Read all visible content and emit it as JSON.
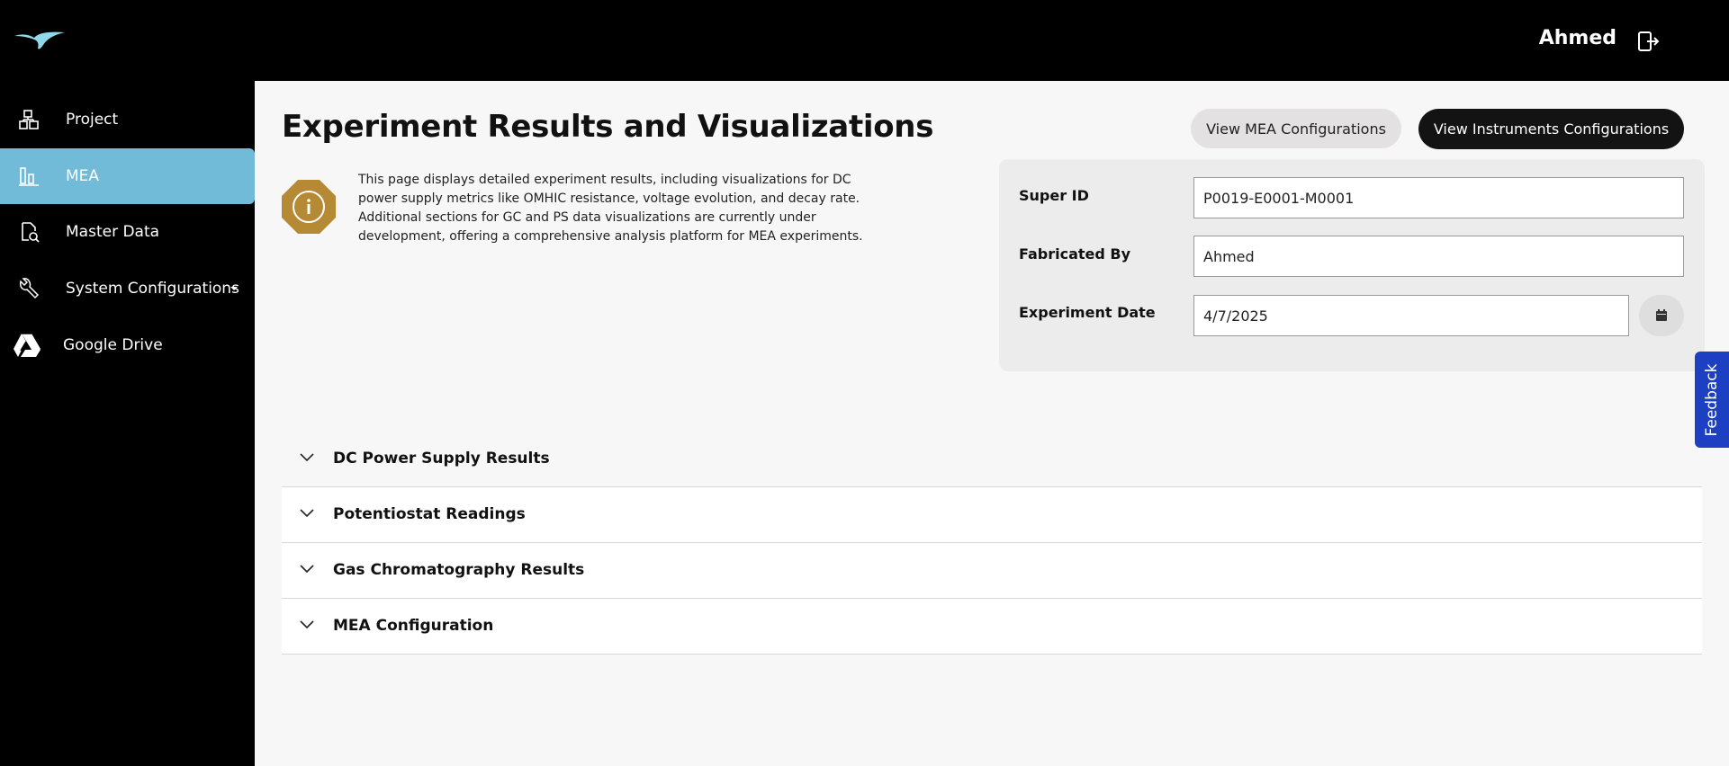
{
  "header": {
    "user_name": "Ahmed",
    "brand_color": "#71bbd9"
  },
  "sidebar": {
    "items": [
      {
        "label": "Project",
        "icon": "project-icon",
        "active": false
      },
      {
        "label": "MEA",
        "icon": "chart-icon",
        "active": true
      },
      {
        "label": "Master Data",
        "icon": "master-data-icon",
        "active": false
      },
      {
        "label": "System Configurations",
        "icon": "wrench-icon",
        "active": false,
        "has_dropdown": true
      },
      {
        "label": "Google Drive",
        "icon": "google-drive-icon",
        "active": false
      }
    ]
  },
  "main": {
    "title": "Experiment Results and Visualizations",
    "buttons": {
      "view_mea": "View MEA Configurations",
      "view_instruments": "View Instruments Configurations"
    },
    "info_text": "This page displays detailed experiment results, including visualizations for DC power supply metrics like OMHIC resistance, voltage evolution, and decay rate. Additional sections for GC and PS data visualizations are currently under development, offering a comprehensive analysis platform for MEA experiments.",
    "form": {
      "super_id_label": "Super ID",
      "super_id_value": "P0019-E0001-M0001",
      "fabricated_by_label": "Fabricated By",
      "fabricated_by_value": "Ahmed",
      "experiment_date_label": "Experiment Date",
      "experiment_date_value": "4/7/2025"
    },
    "sections": [
      {
        "label": "DC Power Supply Results"
      },
      {
        "label": "Potentiostat Readings"
      },
      {
        "label": "Gas Chromatography Results"
      },
      {
        "label": "MEA Configuration"
      }
    ]
  },
  "feedback": {
    "label": "Feedback",
    "color": "#1d3fc2"
  }
}
